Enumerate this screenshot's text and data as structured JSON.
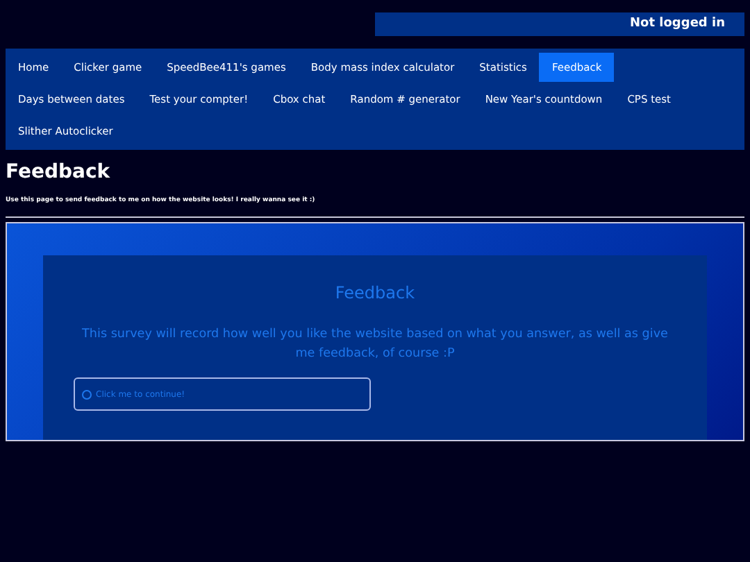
{
  "login_status": "Not logged in",
  "nav": [
    {
      "label": "Home",
      "selected": false
    },
    {
      "label": "Clicker game",
      "selected": false
    },
    {
      "label": "SpeedBee411's games",
      "selected": false
    },
    {
      "label": "Body mass index calculator",
      "selected": false
    },
    {
      "label": "Statistics",
      "selected": false
    },
    {
      "label": "Feedback",
      "selected": true
    },
    {
      "label": "Days between dates",
      "selected": false
    },
    {
      "label": "Test your compter!",
      "selected": false
    },
    {
      "label": "Cbox chat",
      "selected": false
    },
    {
      "label": "Random # generator",
      "selected": false
    },
    {
      "label": "New Year's countdown",
      "selected": false
    },
    {
      "label": "CPS test",
      "selected": false
    },
    {
      "label": "Slither Autoclicker",
      "selected": false
    }
  ],
  "page_title": "Feedback",
  "intro": "Use this page to send feedback to me on how the website looks! I really wanna see it :)",
  "survey": {
    "title": "Feedback",
    "description": "This survey will record how well you like the website based on what you answer, as well as give me feedback, of course :P",
    "option": {
      "label": "Click me to continue!",
      "checked": false
    }
  }
}
